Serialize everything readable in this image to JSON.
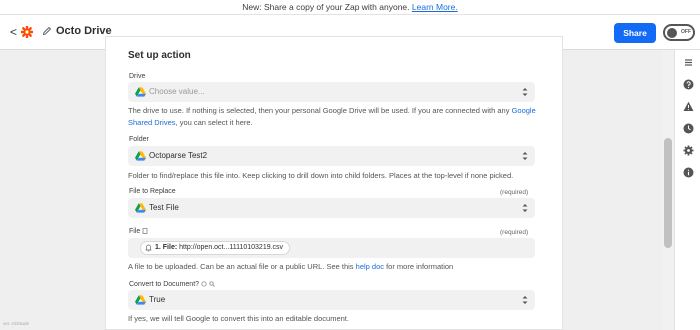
{
  "banner": {
    "text": "New: Share a copy of your Zap with anyone.",
    "link": "Learn More."
  },
  "header": {
    "back": "<",
    "title": "Octo Drive",
    "share": "Share",
    "toggle": "OFF"
  },
  "step_title": "Set up action",
  "fields": [
    {
      "label": "Drive",
      "required": "",
      "value": "Choose value...",
      "placeholder": true,
      "help_pre": "The drive to use. If nothing is selected, then your personal Google Drive will be used. If you are connected with any ",
      "help_link": "Google Shared Drives",
      "help_post": ", you can select it here."
    },
    {
      "label": "Folder",
      "required": "",
      "value": "Octoparse Test2",
      "help": "Folder to find/replace this file into. Keep clicking to drill down into child folders. Places at the top-level if none picked."
    },
    {
      "label": "File to Replace",
      "required": "(required)",
      "value": "Test File"
    },
    {
      "label": "File",
      "required": "(required)",
      "chip_bold": "1. File:",
      "chip_text": "http://open.oct...11110103219.csv",
      "help_pre": "A file to be uploaded. Can be an actual file or a public URL. See this ",
      "help_link": "help doc",
      "help_post": " for more information"
    },
    {
      "label": "Convert to Document?",
      "required": "",
      "value": "True",
      "help": "If yes, we will tell Google to convert this into an editable document."
    }
  ],
  "version": "ver. e1b3ude",
  "colors": {
    "accent": "#136bf5",
    "brand": "#ff4a00",
    "link": "#1b6cd8"
  },
  "icons": {
    "logo": "zapier-logo-icon",
    "edit": "pencil-icon",
    "rail": [
      "outline-icon",
      "help-icon",
      "alert-icon",
      "history-icon",
      "settings-icon",
      "info-icon"
    ]
  }
}
